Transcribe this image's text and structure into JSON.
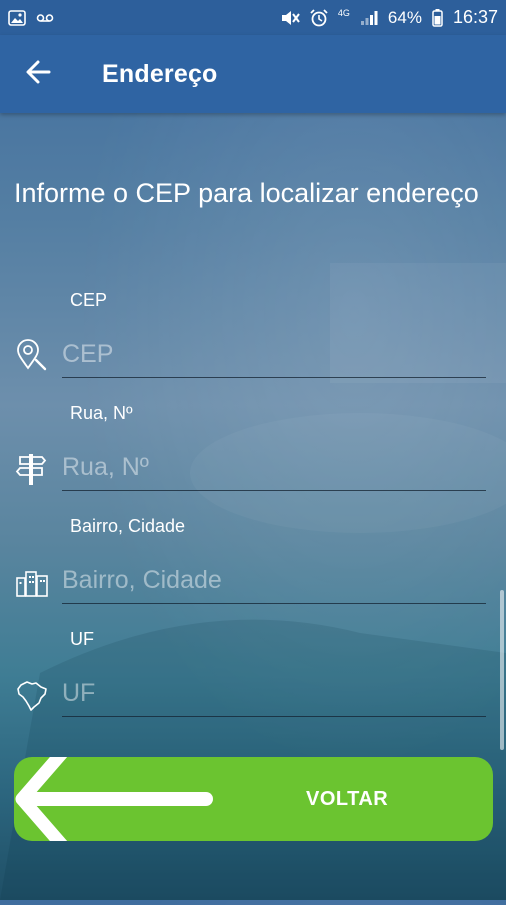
{
  "status_bar": {
    "battery_percent": "64%",
    "network": "4G",
    "time": "16:37",
    "icons": [
      "image-icon",
      "voicemail-icon",
      "mute-icon",
      "alarm-icon",
      "signal-icon",
      "battery-icon"
    ]
  },
  "app_bar": {
    "title": "Endereço",
    "back_icon": "arrow-left-icon"
  },
  "form": {
    "instructions": "Informe o CEP para localizar endereço",
    "fields": [
      {
        "label": "CEP",
        "placeholder": "CEP",
        "value": "",
        "icon": "location-search-icon"
      },
      {
        "label": "Rua, Nº",
        "placeholder": "Rua, Nº",
        "value": "",
        "icon": "signpost-icon"
      },
      {
        "label": "Bairro, Cidade",
        "placeholder": "Bairro, Cidade",
        "value": "",
        "icon": "city-icon"
      },
      {
        "label": "UF",
        "placeholder": "UF",
        "value": "",
        "icon": "brazil-map-icon"
      }
    ]
  },
  "voltar_button": {
    "label": "VOLTAR",
    "icon": "arrow-left-icon"
  },
  "colors": {
    "app_bar": "#2f64a3",
    "status_bar": "#2d5f9b",
    "button": "#6bc430",
    "text": "#ffffff"
  }
}
